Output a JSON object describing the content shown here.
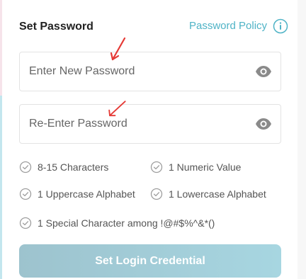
{
  "header": {
    "title": "Set Password",
    "policy_link": "Password Policy",
    "info_icon": "info-circle-icon"
  },
  "fields": {
    "new_password_placeholder": "Enter New Password",
    "new_password_value": "",
    "reenter_password_placeholder": "Re-Enter Password",
    "reenter_password_value": "",
    "toggle_icon": "eye-icon"
  },
  "rules": [
    {
      "label": "8-15 Characters"
    },
    {
      "label": "1 Numeric Value"
    },
    {
      "label": "1 Uppercase Alphabet"
    },
    {
      "label": "1 Lowercase Alphabet"
    },
    {
      "label": "1 Special Character among !@#$%^&*()"
    }
  ],
  "submit": {
    "label": "Set Login Credential"
  },
  "colors": {
    "accent": "#4fb3c6",
    "button_gradient_start": "#9dc3ce",
    "button_gradient_end": "#a7d6e1",
    "annotation_arrow": "#e53935",
    "check_gray": "#9e9e9e"
  }
}
